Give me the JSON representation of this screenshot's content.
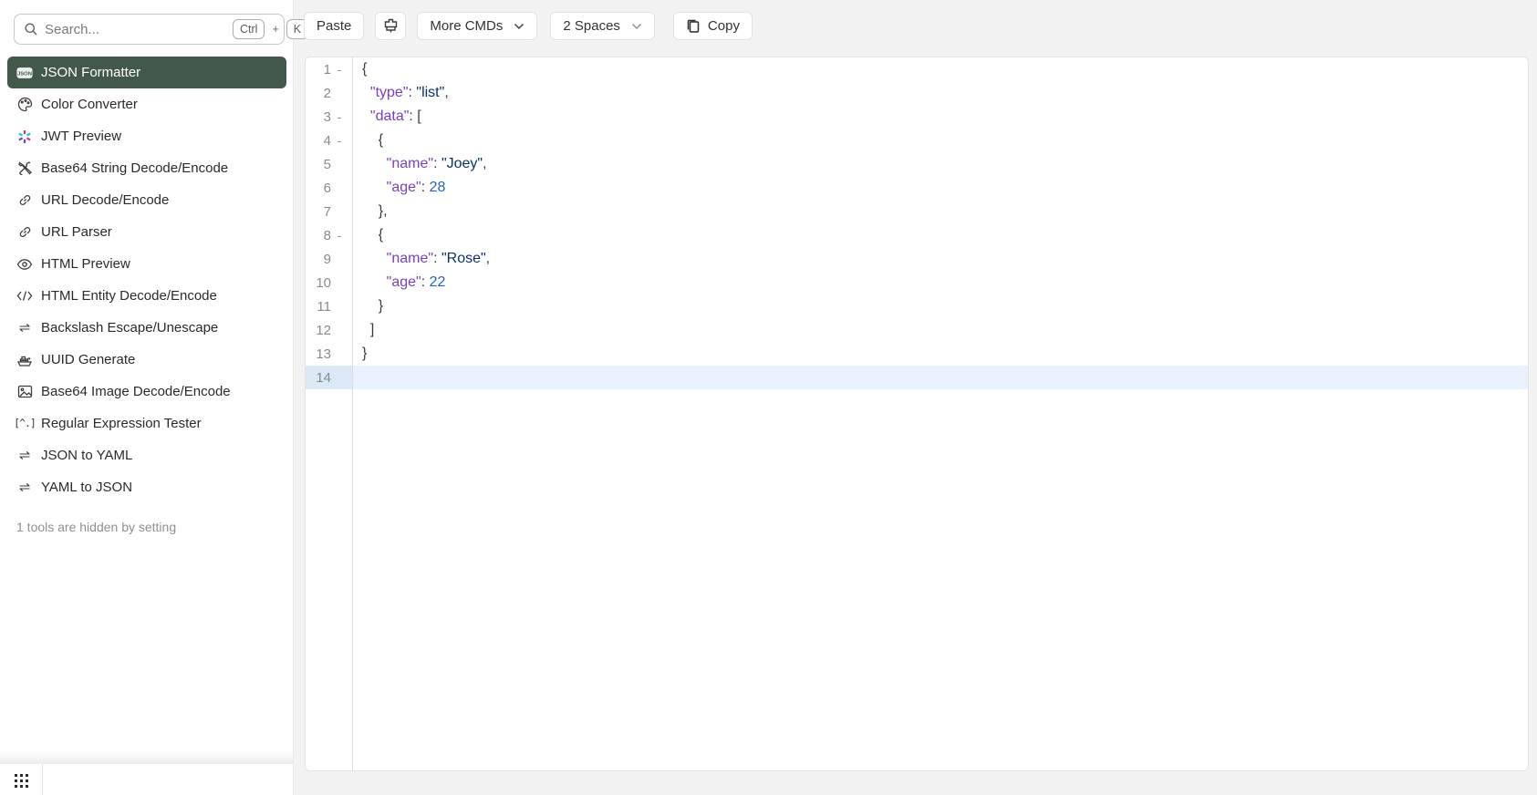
{
  "sidebar": {
    "search": {
      "placeholder": "Search...",
      "shortcut": [
        "Ctrl",
        "K"
      ],
      "shortcut_joiner": "+"
    },
    "items": [
      {
        "label": "JSON Formatter",
        "icon": "json-badge",
        "selected": true
      },
      {
        "label": "Color Converter",
        "icon": "palette",
        "selected": false
      },
      {
        "label": "JWT Preview",
        "icon": "jwt-burst",
        "selected": false
      },
      {
        "label": "Base64 String Decode/Encode",
        "icon": "tools",
        "selected": false
      },
      {
        "label": "URL Decode/Encode",
        "icon": "link",
        "selected": false
      },
      {
        "label": "URL Parser",
        "icon": "link",
        "selected": false
      },
      {
        "label": "HTML Preview",
        "icon": "eye",
        "selected": false
      },
      {
        "label": "HTML Entity Decode/Encode",
        "icon": "code",
        "selected": false
      },
      {
        "label": "Backslash Escape/Unescape",
        "icon": "swap",
        "selected": false
      },
      {
        "label": "UUID Generate",
        "icon": "ship",
        "selected": false
      },
      {
        "label": "Base64 Image Decode/Encode",
        "icon": "image",
        "selected": false
      },
      {
        "label": "Regular Expression Tester",
        "icon": "regex",
        "selected": false
      },
      {
        "label": "JSON to YAML",
        "icon": "swap",
        "selected": false
      },
      {
        "label": "YAML to JSON",
        "icon": "swap",
        "selected": false
      }
    ],
    "footer_note": "1 tools are hidden by setting"
  },
  "toolbar": {
    "paste_label": "Paste",
    "more_cmds_label": "More CMDs",
    "indent_label": "2 Spaces",
    "copy_label": "Copy"
  },
  "editor": {
    "active_line": 14,
    "fold_lines": [
      1,
      3,
      4,
      8
    ],
    "lines": [
      [
        {
          "t": "p",
          "v": "{"
        }
      ],
      [
        {
          "t": "p",
          "v": "  "
        },
        {
          "t": "k",
          "v": "\"type\""
        },
        {
          "t": "p",
          "v": ": "
        },
        {
          "t": "s",
          "v": "\"list\""
        },
        {
          "t": "p",
          "v": ","
        }
      ],
      [
        {
          "t": "p",
          "v": "  "
        },
        {
          "t": "k",
          "v": "\"data\""
        },
        {
          "t": "p",
          "v": ": ["
        }
      ],
      [
        {
          "t": "p",
          "v": "    {"
        }
      ],
      [
        {
          "t": "p",
          "v": "      "
        },
        {
          "t": "k",
          "v": "\"name\""
        },
        {
          "t": "p",
          "v": ": "
        },
        {
          "t": "s",
          "v": "\"Joey\""
        },
        {
          "t": "p",
          "v": ","
        }
      ],
      [
        {
          "t": "p",
          "v": "      "
        },
        {
          "t": "k",
          "v": "\"age\""
        },
        {
          "t": "p",
          "v": ": "
        },
        {
          "t": "n",
          "v": "28"
        }
      ],
      [
        {
          "t": "p",
          "v": "    },"
        }
      ],
      [
        {
          "t": "p",
          "v": "    {"
        }
      ],
      [
        {
          "t": "p",
          "v": "      "
        },
        {
          "t": "k",
          "v": "\"name\""
        },
        {
          "t": "p",
          "v": ": "
        },
        {
          "t": "s",
          "v": "\"Rose\""
        },
        {
          "t": "p",
          "v": ","
        }
      ],
      [
        {
          "t": "p",
          "v": "      "
        },
        {
          "t": "k",
          "v": "\"age\""
        },
        {
          "t": "p",
          "v": ": "
        },
        {
          "t": "n",
          "v": "22"
        }
      ],
      [
        {
          "t": "p",
          "v": "    }"
        }
      ],
      [
        {
          "t": "p",
          "v": "  ]"
        }
      ],
      [
        {
          "t": "p",
          "v": "}"
        }
      ],
      []
    ]
  },
  "colors": {
    "accent_green": "#42584a",
    "page_bg": "#f1f2f1",
    "key_color": "#7a3fc4",
    "string_color": "#0a3069",
    "number_color": "#1f61c9",
    "active_line_bg": "#e9f2fc",
    "active_gutter_bg": "#dbe9f7"
  }
}
